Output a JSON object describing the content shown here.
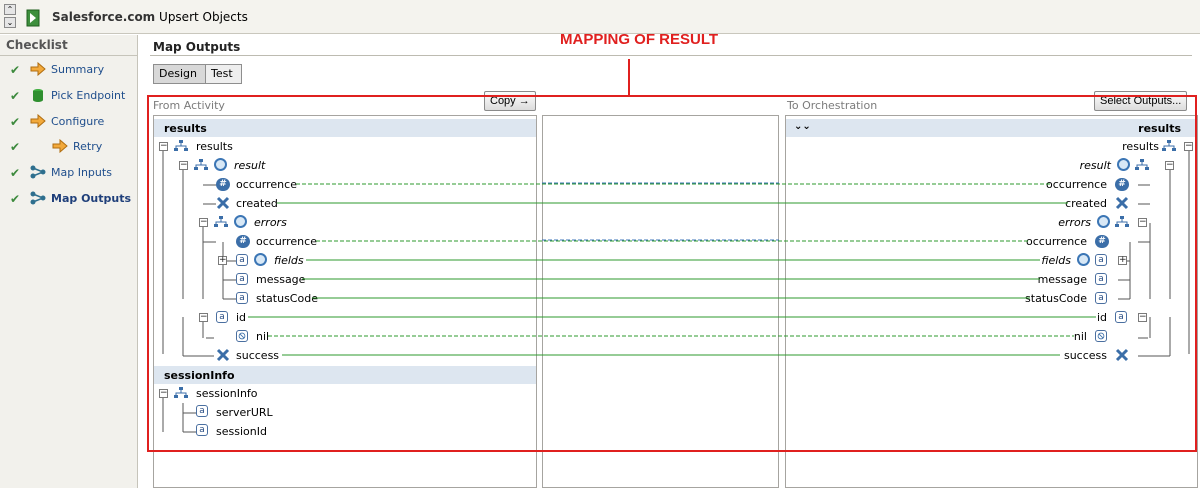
{
  "window": {
    "brand": "Salesforce.com",
    "title": "Upsert Objects"
  },
  "sidebar": {
    "title": "Checklist",
    "items": [
      {
        "label": "Summary",
        "icon": "arrow-right-icon"
      },
      {
        "label": "Pick Endpoint",
        "icon": "database-icon"
      },
      {
        "label": "Configure",
        "icon": "arrow-right-icon"
      },
      {
        "label": "Retry",
        "icon": "arrow-right-icon"
      },
      {
        "label": "Map Inputs",
        "icon": "mapping-icon"
      },
      {
        "label": "Map Outputs",
        "icon": "mapping-icon",
        "active": true
      }
    ]
  },
  "main": {
    "title": "Map Outputs",
    "tabs": [
      "Design",
      "Test"
    ],
    "annotation": "MAPPING OF RESULT",
    "from_label": "From Activity",
    "to_label": "To Orchestration",
    "copy_button": "Copy",
    "select_outputs_button": "Select Outputs..."
  },
  "left_tree": {
    "results_header": "results",
    "results": "results",
    "result": "result",
    "occurrence": "occurrence",
    "created": "created",
    "errors": "errors",
    "err_occurrence": "occurrence",
    "fields": "fields",
    "message": "message",
    "statusCode": "statusCode",
    "id": "id",
    "nil": "nil",
    "success": "success",
    "session_header": "sessionInfo",
    "sessionInfo": "sessionInfo",
    "serverURL": "serverURL",
    "sessionId": "sessionId"
  },
  "right_tree": {
    "results_header": "results",
    "results": "results",
    "result": "result",
    "occurrence": "occurrence",
    "created": "created",
    "errors": "errors",
    "err_occurrence": "occurrence",
    "fields": "fields",
    "message": "message",
    "statusCode": "statusCode",
    "id": "id",
    "nil": "nil",
    "success": "success"
  },
  "colors": {
    "annotation": "#e0201f",
    "map_line_solid": "#2e9a2e",
    "map_line_dashed_blue": "#3d74b8"
  }
}
